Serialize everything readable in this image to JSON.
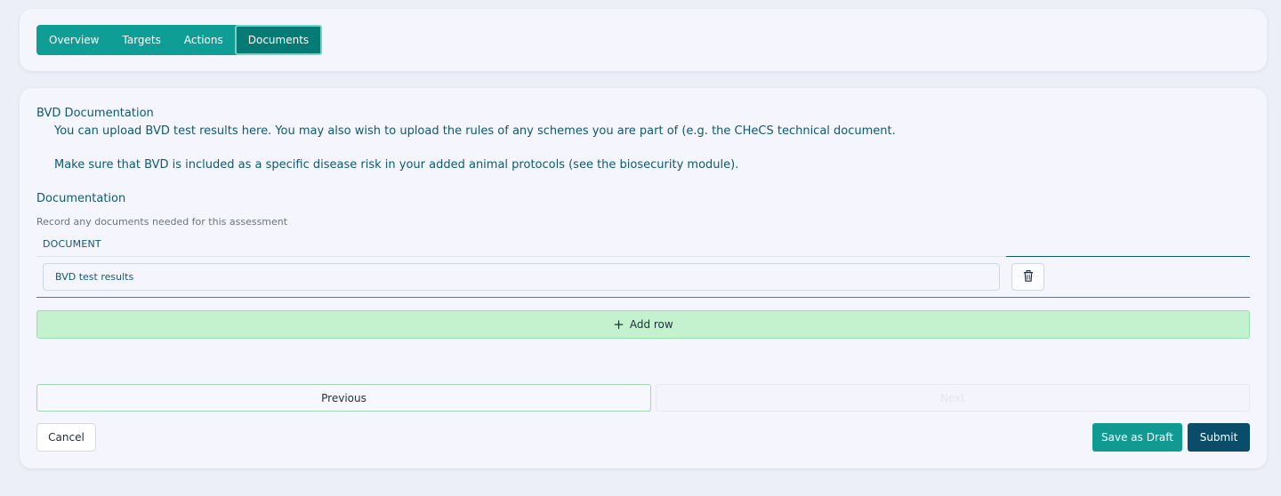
{
  "tabs": [
    {
      "label": "Overview",
      "active": false
    },
    {
      "label": "Targets",
      "active": false
    },
    {
      "label": "Actions",
      "active": false
    },
    {
      "label": "Documents",
      "active": true
    }
  ],
  "bvd": {
    "title": "BVD Documentation",
    "line1": "You can upload BVD test results here. You may also wish to upload the rules of any schemes you are part of (e.g. the CHeCS technical document.",
    "line2": "Make sure that BVD is included as a specific disease risk in your added animal protocols (see the biosecurity module)."
  },
  "documentation": {
    "title": "Documentation",
    "hint": "Record any documents needed for this assessment",
    "column_header": "DOCUMENT",
    "rows": [
      {
        "value": "BVD test results"
      }
    ],
    "delete_icon": "trash-icon",
    "add_row_icon": "plus-icon",
    "add_row_label": "Add row"
  },
  "nav": {
    "previous_label": "Previous",
    "next_label": "Next"
  },
  "footer": {
    "cancel_label": "Cancel",
    "save_draft_label": "Save as Draft",
    "submit_label": "Submit"
  },
  "colors": {
    "tab_bar": "#0f9e96",
    "tab_active": "#067a74",
    "heading_text": "#0e5872",
    "add_row_bg": "#c4f2cf",
    "save_draft": "#119a92",
    "submit": "#0a4d6b"
  }
}
